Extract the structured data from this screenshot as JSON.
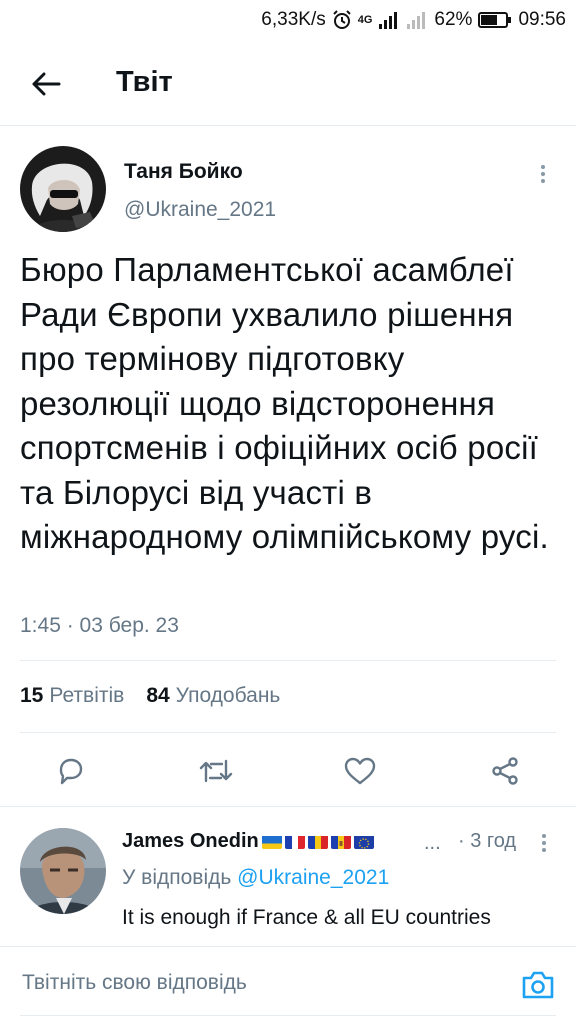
{
  "status_bar": {
    "network_speed": "6,33K/s",
    "network_type": "4G",
    "battery": "62%",
    "time": "09:56",
    "icons": [
      "alarm-icon",
      "signal-icon",
      "signal-icon-2",
      "battery-icon"
    ]
  },
  "header": {
    "title": "Твіт",
    "back_icon": "arrow-left-icon"
  },
  "tweet": {
    "author_name": "Таня Бойко",
    "author_handle": "@Ukraine_2021",
    "text": "Бюро Парламентської асамблеї Ради Європи ухвалило рішення про термінову підготовку резолюції щодо відсторонення спортсменів і офіційних осіб росії та Білорусі від участі в міжнародному олімпійському русі.",
    "timestamp": "1:45 · 03 бер. 23",
    "retweets_count": "15",
    "retweets_label": "Ретвітів",
    "likes_count": "84",
    "likes_label": "Уподобань",
    "actions": [
      "reply-icon",
      "retweet-icon",
      "like-icon",
      "share-icon"
    ]
  },
  "reply": {
    "author_name": "James Onedin",
    "flags": [
      "ukraine-flag",
      "france-flag",
      "romania-flag",
      "moldova-flag",
      "eu-flag"
    ],
    "ellipsis": "...",
    "time": "· 3 год",
    "reply_prefix": "У відповідь",
    "reply_handle": "@Ukraine_2021",
    "text": "It is enough if France & all EU countries"
  },
  "compose": {
    "placeholder": "Твітніть свою відповідь",
    "camera_icon": "camera-icon"
  },
  "colors": {
    "accent": "#1da1f2",
    "secondary_text": "#657786",
    "divider": "#e6ecf0"
  }
}
